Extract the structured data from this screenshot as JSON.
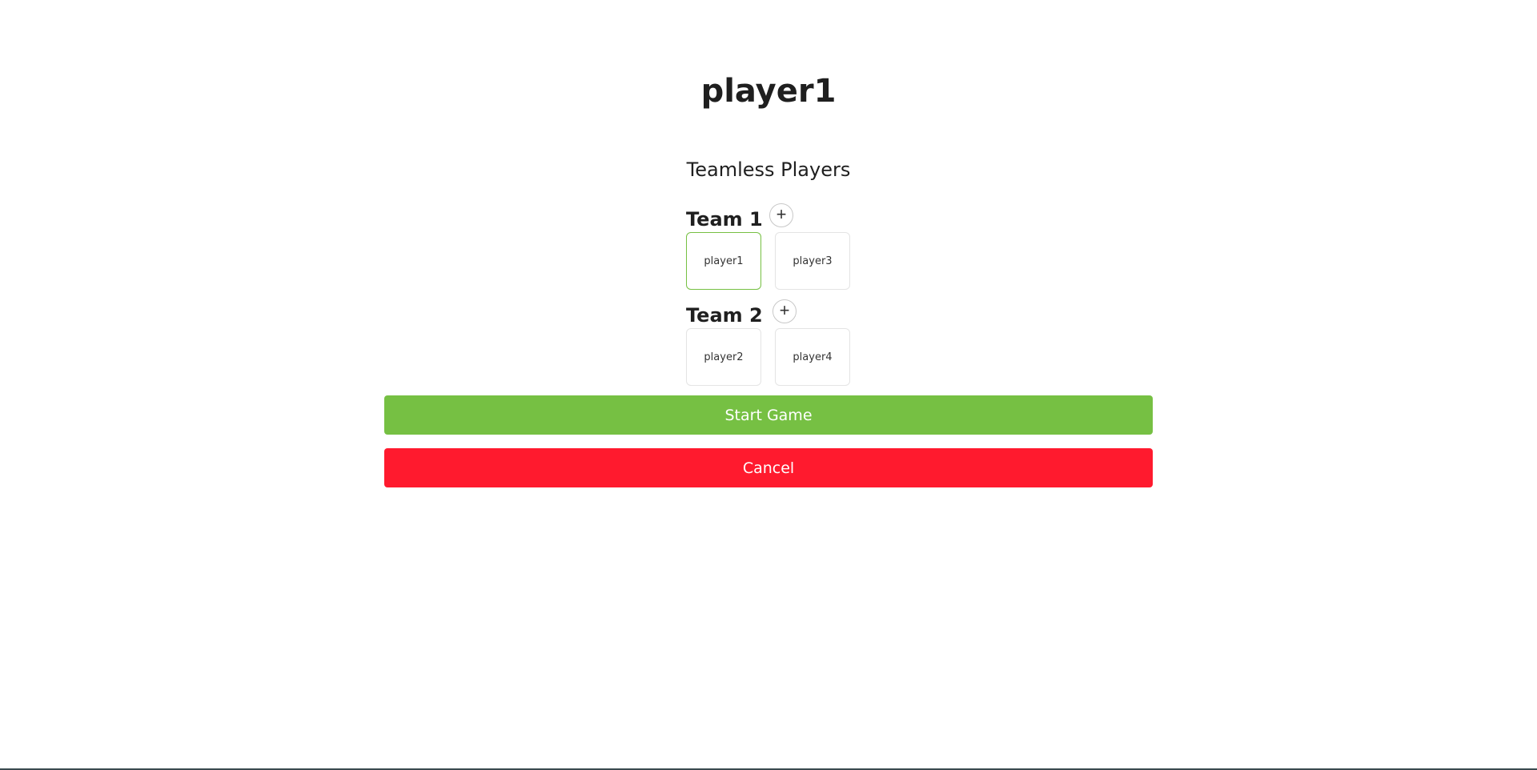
{
  "title": "player1",
  "teamless_heading": "Teamless Players",
  "teams": [
    {
      "name": "Team 1",
      "add_label": "+",
      "players": [
        {
          "name": "player1",
          "selected": true
        },
        {
          "name": "player3",
          "selected": false
        }
      ]
    },
    {
      "name": "Team 2",
      "add_label": "+",
      "players": [
        {
          "name": "player2",
          "selected": false
        },
        {
          "name": "player4",
          "selected": false
        }
      ]
    }
  ],
  "actions": {
    "start_label": "Start Game",
    "cancel_label": "Cancel"
  },
  "colors": {
    "accent_green": "#76c043",
    "danger_red": "#ff1a2e"
  }
}
